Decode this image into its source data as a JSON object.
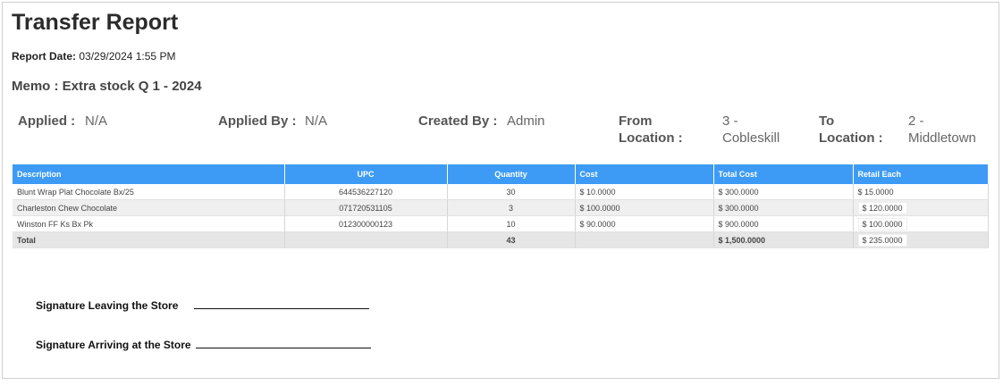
{
  "report": {
    "title": "Transfer Report",
    "date_label": "Report Date:",
    "date_value": "03/29/2024 1:55 PM",
    "memo": "Memo : Extra stock Q 1 - 2024"
  },
  "meta": {
    "applied_label": "Applied :",
    "applied_value": "N/A",
    "applied_by_label": "Applied By :",
    "applied_by_value": "N/A",
    "created_by_label": "Created By :",
    "created_by_value": "Admin",
    "from_label_1": "From",
    "from_label_2": "Location :",
    "from_value_1": "3 -",
    "from_value_2": "Cobleskill",
    "to_label_1": "To",
    "to_label_2": "Location :",
    "to_value_1": "2 -",
    "to_value_2": "Middletown"
  },
  "table": {
    "headers": [
      "Description",
      "UPC",
      "Quantity",
      "Cost",
      "Total Cost",
      "Retail Each"
    ],
    "rows": [
      [
        "Blunt Wrap Plat Chocolate Bx/25",
        "644536227120",
        "30",
        "$ 10.0000",
        "$ 300.0000",
        "$ 15.0000"
      ],
      [
        "Charleston Chew Chocolate",
        "071720531105",
        "3",
        "$ 100.0000",
        "$ 300.0000",
        "$ 120.0000"
      ],
      [
        "Winston FF Ks Bx Pk",
        "012300000123",
        "10",
        "$ 90.0000",
        "$ 900.0000",
        "$ 100.0000"
      ]
    ],
    "total": [
      "Total",
      "",
      "43",
      "",
      "$ 1,500.0000",
      "$ 235.0000"
    ]
  },
  "signatures": {
    "leaving": "Signature Leaving the Store",
    "arriving": "Signature Arriving at the Store"
  },
  "colors": {
    "header_bg": "#3d9bf5",
    "header_text": "#ffffff"
  }
}
